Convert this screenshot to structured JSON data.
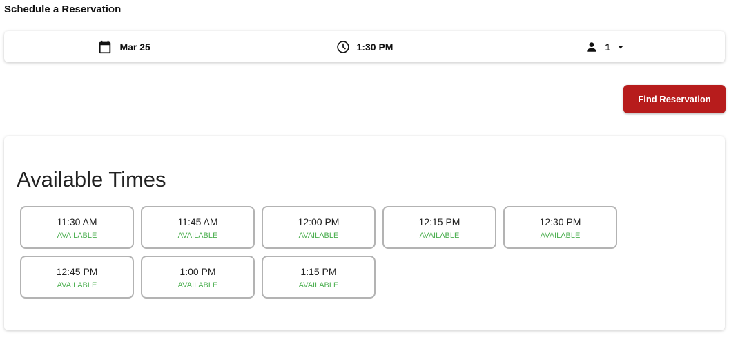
{
  "page": {
    "title": "Schedule a Reservation"
  },
  "pickers": {
    "date": {
      "value": "Mar 25",
      "icon": "calendar-icon"
    },
    "time": {
      "value": "1:30 PM",
      "icon": "clock-icon"
    },
    "party": {
      "value": "1",
      "icon": "person-icon",
      "dropdown_icon": "caret-down-icon"
    }
  },
  "actions": {
    "find_label": "Find Reservation",
    "accent_color": "#b71c1c"
  },
  "times": {
    "heading": "Available Times",
    "status_color": "#4caf50",
    "slots": [
      {
        "time": "11:30 AM",
        "status": "AVAILABLE"
      },
      {
        "time": "11:45 AM",
        "status": "AVAILABLE"
      },
      {
        "time": "12:00 PM",
        "status": "AVAILABLE"
      },
      {
        "time": "12:15 PM",
        "status": "AVAILABLE"
      },
      {
        "time": "12:30 PM",
        "status": "AVAILABLE"
      },
      {
        "time": "12:45 PM",
        "status": "AVAILABLE"
      },
      {
        "time": "1:00 PM",
        "status": "AVAILABLE"
      },
      {
        "time": "1:15 PM",
        "status": "AVAILABLE"
      }
    ]
  }
}
